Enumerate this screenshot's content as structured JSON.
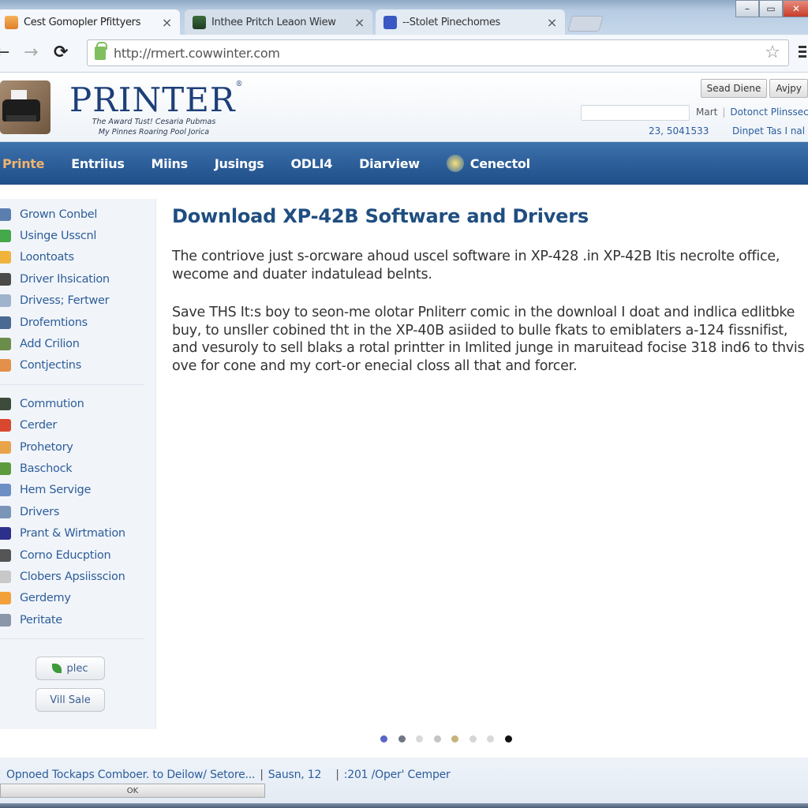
{
  "browser": {
    "tabs": [
      {
        "label": "Cest Gomopler Pfittyers",
        "favicon": "orange-bag-icon",
        "active": true
      },
      {
        "label": "Inthee Pritch Leaon Wiew",
        "favicon": "green-app-icon",
        "active": false
      },
      {
        "label": "--Stolet Pinechomes",
        "favicon": "blue-discord-icon",
        "active": false
      }
    ],
    "close_glyph": "×",
    "url": "http://rmert.cowwinter.com",
    "window_controls": {
      "minimize": "–",
      "maximize": "▭",
      "close": "✕"
    },
    "nav": {
      "back": "←",
      "forward": "→",
      "reload": "⟳"
    },
    "bookmark_glyph": "☆"
  },
  "header": {
    "brand": "PRINTER",
    "brand_mark": "®",
    "tagline_line1": "The Award Tust! Cesaria Pubmas",
    "tagline_line2": "My Pinnes Roaring Pool Jorica",
    "buttons": [
      "Sead Diene",
      "Avjpy"
    ],
    "search_value": "",
    "link_plain": "Mart",
    "link_1": "Dotonct Plinssec",
    "phone": "23, 5041533",
    "link_2": "Dinpet Tas I nal"
  },
  "mainnav": {
    "items": [
      {
        "label": "Printe",
        "active": true
      },
      {
        "label": "Entriius"
      },
      {
        "label": "Miins"
      },
      {
        "label": "Jusings"
      },
      {
        "label": "ODLI4"
      },
      {
        "label": "Diarview"
      },
      {
        "label": "Cenectol",
        "icon": "globe-icon"
      }
    ]
  },
  "sidebar": {
    "group1": [
      {
        "label": "Grown Conbel",
        "icon": "monitor-icon",
        "color": "#5a7fae"
      },
      {
        "label": "Usinge Usscnl",
        "icon": "green-orb-icon",
        "color": "#45a84a"
      },
      {
        "label": "Loontoats",
        "icon": "crown-icon",
        "color": "#f0b43c"
      },
      {
        "label": "Driver Ihsication",
        "icon": "pen-icon",
        "color": "#4a4a4a"
      },
      {
        "label": "Drivess; Fertwer",
        "icon": "printer-icon",
        "color": "#9fb3cc"
      },
      {
        "label": "Drofemtions",
        "icon": "window-icon",
        "color": "#4a6a94"
      },
      {
        "label": "Add Crilion",
        "icon": "chart-icon",
        "color": "#6c8c4a"
      },
      {
        "label": "Contjectins",
        "icon": "envelope-icon",
        "color": "#e2904a"
      }
    ],
    "group2": [
      {
        "label": "Commution",
        "icon": "dark-orb-icon",
        "color": "#3d4b3a"
      },
      {
        "label": "Cerder",
        "icon": "red-arrow-icon",
        "color": "#d9472e"
      },
      {
        "label": "Prohetory",
        "icon": "folder-icon",
        "color": "#e9a44a"
      },
      {
        "label": "Baschock",
        "icon": "check-shield-icon",
        "color": "#5b9b3e"
      },
      {
        "label": "Hem Servige",
        "icon": "globe-icon",
        "color": "#6c8fc4"
      },
      {
        "label": "Drivers",
        "icon": "users-icon",
        "color": "#7b95b8"
      },
      {
        "label": "Prant & Wirtmation",
        "icon": "screen-icon",
        "color": "#2d2f8c"
      },
      {
        "label": "Corno Educption",
        "icon": "tool-icon",
        "color": "#555555"
      },
      {
        "label": "Clobers Apsiisscion",
        "icon": "document-icon",
        "color": "#c8c8c8"
      },
      {
        "label": "Gerdemy",
        "icon": "apps-icon",
        "color": "#f2a13a"
      },
      {
        "label": "Peritate",
        "icon": "computer-icon",
        "color": "#8a97a8"
      }
    ],
    "buttons": [
      {
        "label": "plec",
        "icon": "leaf-icon"
      },
      {
        "label": "Vill Sale"
      }
    ]
  },
  "content": {
    "title": "Download XP-42B Software and Drivers",
    "paragraphs": [
      "The contriove just s-orcware ahoud uscel software in XP-428 .in XP-42B Itis necrolte office, wecome and duater indatulead belnts.",
      "Save THS It:s boy to seon-me olotar Pnliterr comic in the downloal I doat and indlica edlitbke buy, to unsller cobined tht in the XP-40B asiided to bulle fkats to emiblaters a-124 fissnifist, and vesuroly to sell blaks a rotal printter in Imlited junge in maruitead focise 318 ind6 to thvis ove for cone and my cort-or enecial closs all that and forcer."
    ]
  },
  "carousel": {
    "dot_count": 8,
    "active_index": 7,
    "dot_colors": [
      "#5a63c8",
      "#6f7785",
      "#d9d9d9",
      "#c4c4c4",
      "#c7b27a",
      "#d6d6d6",
      "#d9d9d9",
      "#111111"
    ]
  },
  "statusbar": {
    "text_1": "Opnoed Tockaps Comboer. to Deilow/ Setore...",
    "text_2": "Sausn, 12",
    "text_3": ":201 /Oper' Cemper",
    "ok_label": "OK"
  }
}
